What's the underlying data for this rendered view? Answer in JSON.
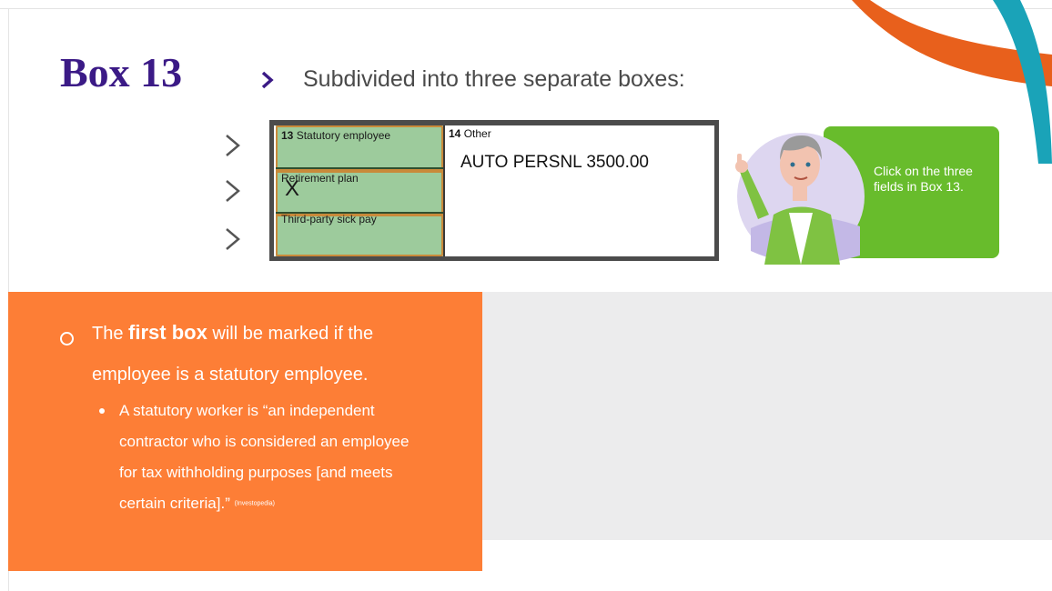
{
  "slide": {
    "title": "Box 13",
    "subtitle": "Subdivided into three separate boxes:",
    "colors": {
      "title": "#3b1a86",
      "orange": "#fd7e36",
      "green_box": "#9dcb9c",
      "callout": "#68bc2c",
      "gray": "#ececed"
    }
  },
  "form": {
    "box13_label_num": "13",
    "box13_label": "Statutory employee",
    "retirement_label": "Retirement plan",
    "retirement_mark": "X",
    "sick_pay_label": "Third-party sick pay",
    "box14_num": "14",
    "box14_label": "Other",
    "box14_value": "AUTO PERSNL 3500.00"
  },
  "callout": {
    "text": "Click on the three fields in Box 13."
  },
  "notes": {
    "line1_pre": "The ",
    "line1_bold": "first box",
    "line1_post": " will be marked if the",
    "line2": "employee is a statutory employee.",
    "quote_lines": [
      "A statutory worker is “an independent",
      "contractor who is considered an employee",
      "for tax withholding purposes [and meets",
      "certain criteria].”"
    ],
    "citation": "(Investopedia)"
  }
}
